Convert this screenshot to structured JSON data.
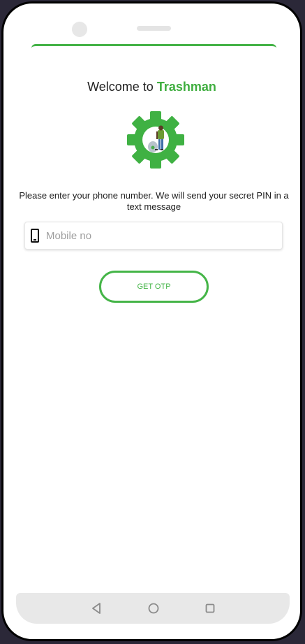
{
  "header": {
    "welcome_prefix": "Welcome to",
    "brand_name": "Trashman"
  },
  "instructions": "Please enter your phone number. We will send your secret PIN in a text message",
  "mobile_field": {
    "icon": "mobile-phone-icon",
    "placeholder": "Mobile no",
    "value": ""
  },
  "otp_button": {
    "label": "GET OTP"
  },
  "navigation": {
    "back_icon": "triangle-back-icon",
    "home_icon": "circle-home-icon",
    "recents_icon": "square-recents-icon"
  },
  "colors": {
    "brand_green": "#3fae3f",
    "button_green": "#45b548",
    "device_background": "#2b2838"
  }
}
